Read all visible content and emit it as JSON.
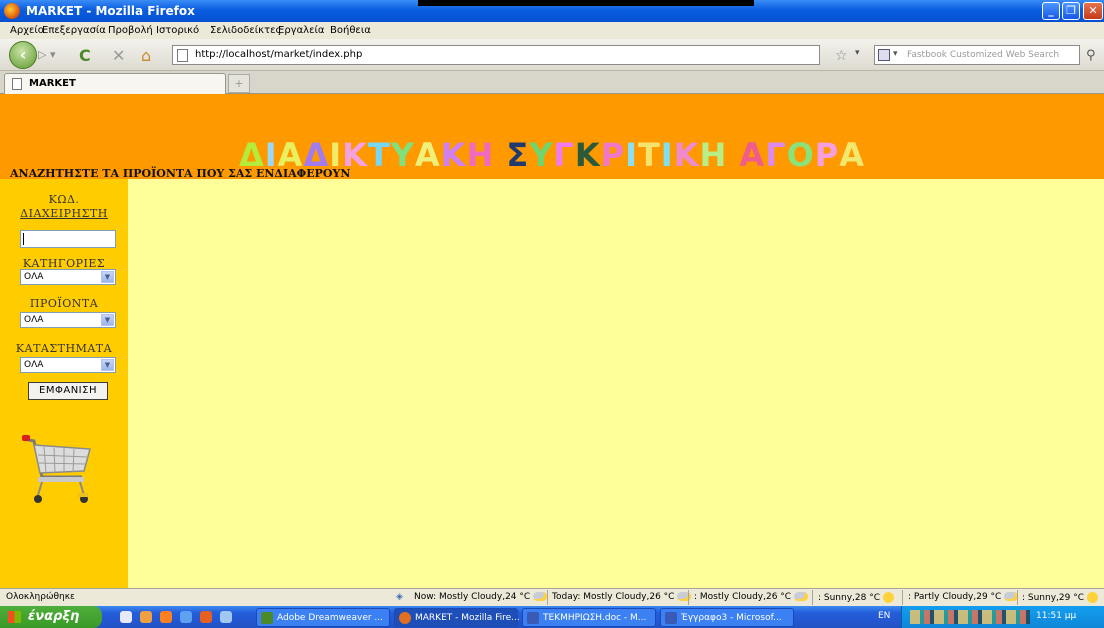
{
  "window": {
    "title": "MARKET - Mozilla Firefox"
  },
  "menubar": {
    "items": [
      "Αρχείο",
      "Επεξεργασία",
      "Προβολή",
      "Ιστορικό",
      "Σελιδοδείκτες",
      "Εργαλεία",
      "Βοήθεια"
    ]
  },
  "navbar": {
    "url": "http://localhost/market/index.php",
    "search_placeholder": "Fastbook Customized Web Search"
  },
  "tabs": [
    {
      "label": "MARKET"
    }
  ],
  "page": {
    "site_title_letters": [
      {
        "ch": "Δ",
        "color": "#b4ec3c"
      },
      {
        "ch": "Ι",
        "color": "#9ad8f5"
      },
      {
        "ch": "Α",
        "color": "#e8f060"
      },
      {
        "ch": "Δ",
        "color": "#a27bf0"
      },
      {
        "ch": "Ι",
        "color": "#f0ec6a"
      },
      {
        "ch": "Κ",
        "color": "#f3a1e0"
      },
      {
        "ch": "Τ",
        "color": "#78d6f5"
      },
      {
        "ch": "Υ",
        "color": "#7fe07c"
      },
      {
        "ch": "Α",
        "color": "#eff07a"
      },
      {
        "ch": "Κ",
        "color": "#cf7ff0"
      },
      {
        "ch": "Η",
        "color": "#f06bc0"
      },
      {
        "ch": " ",
        "color": "#000000"
      },
      {
        "ch": "Σ",
        "color": "#1f3a6e"
      },
      {
        "ch": "Υ",
        "color": "#6fd66e"
      },
      {
        "ch": "Γ",
        "color": "#f07bf0"
      },
      {
        "ch": "Κ",
        "color": "#2a5a3a"
      },
      {
        "ch": "Ρ",
        "color": "#f078c8"
      },
      {
        "ch": "Ι",
        "color": "#8ae1f5"
      },
      {
        "ch": "Τ",
        "color": "#f4e46e"
      },
      {
        "ch": "Ι",
        "color": "#7ce0f2"
      },
      {
        "ch": "Κ",
        "color": "#f08ad0"
      },
      {
        "ch": "Η",
        "color": "#b7ee88"
      },
      {
        "ch": " ",
        "color": "#000000"
      },
      {
        "ch": "Α",
        "color": "#f05c8c"
      },
      {
        "ch": "Γ",
        "color": "#dc8af0"
      },
      {
        "ch": "Ο",
        "color": "#8ae27a"
      },
      {
        "ch": "Ρ",
        "color": "#f59ee0"
      },
      {
        "ch": "Α",
        "color": "#f2e86e"
      }
    ],
    "subtitle": "ΑΝΑΖΗΤΗΣΤΕ ΤΑ ΠΡΟΪΟΝΤΑ ΠΟΥ ΣΑΣ ΕΝΔΙΑΦΕΡΟΥΝ",
    "sidebar": {
      "admin_code_label_1": "ΚΩΔ.",
      "admin_code_label_2": "ΔΙΑΧΕΙΡΗΣΤΗ",
      "categories_label": "ΚΑΤΗΓΟΡΙΕΣ",
      "categories_value": "ΟΛΑ",
      "products_label": "ΠΡΟΪΟΝΤΑ",
      "products_value": "ΟΛΑ",
      "stores_label": "ΚΑΤΑΣΤΗΜΑΤΑ",
      "stores_value": "ΟΛΑ",
      "show_button": "ΕΜΦΑΝΙΣΗ"
    },
    "colors": {
      "header": "#ff9900",
      "sidebar": "#ffcc00",
      "content": "#ffff99"
    }
  },
  "statusbar": {
    "status": "Ολοκληρώθηκε",
    "weather": [
      "Now: Mostly Cloudy,24 °C",
      "Today: Mostly Cloudy,26 °C",
      ": Mostly Cloudy,26 °C",
      ": Sunny,28 °C",
      ": Partly Cloudy,29 °C",
      ": Sunny,29 °C"
    ]
  },
  "taskbar": {
    "start_label": "έναρξη",
    "tasks": [
      "Adobe Dreamweaver ...",
      "MARKET - Mozilla Fire...",
      "ΤΕΚΜΗΡΙΩΣΗ.doc - M...",
      "Έγγραφο3 - Microsof..."
    ],
    "lang": "EN",
    "clock": "11:51 μμ"
  }
}
